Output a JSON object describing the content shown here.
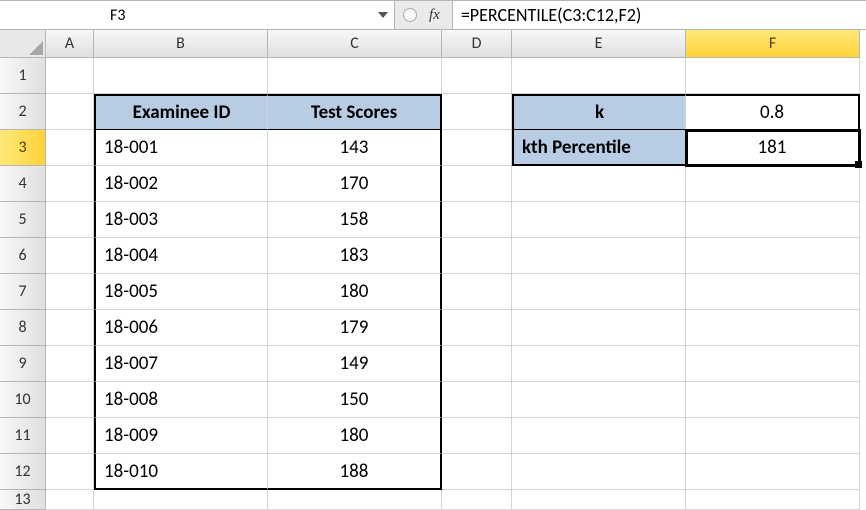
{
  "activeCell": "F3",
  "formula": "=PERCENTILE(C3:C12,F2)",
  "fxLabel": "fx",
  "columns": [
    "A",
    "B",
    "C",
    "D",
    "E",
    "F"
  ],
  "rows": [
    "1",
    "2",
    "3",
    "4",
    "5",
    "6",
    "7",
    "8",
    "9",
    "10",
    "11",
    "12",
    "13"
  ],
  "activeColumn": "F",
  "activeRow": "3",
  "headers": {
    "examinee": "Examinee ID",
    "scores": "Test Scores",
    "k": "k",
    "kth": "kth Percentile"
  },
  "kValue": "0.8",
  "kthResult": "181",
  "data": [
    {
      "id": "18-001",
      "score": "143"
    },
    {
      "id": "18-002",
      "score": "170"
    },
    {
      "id": "18-003",
      "score": "158"
    },
    {
      "id": "18-004",
      "score": "183"
    },
    {
      "id": "18-005",
      "score": "180"
    },
    {
      "id": "18-006",
      "score": "179"
    },
    {
      "id": "18-007",
      "score": "149"
    },
    {
      "id": "18-008",
      "score": "150"
    },
    {
      "id": "18-009",
      "score": "180"
    },
    {
      "id": "18-010",
      "score": "188"
    }
  ]
}
